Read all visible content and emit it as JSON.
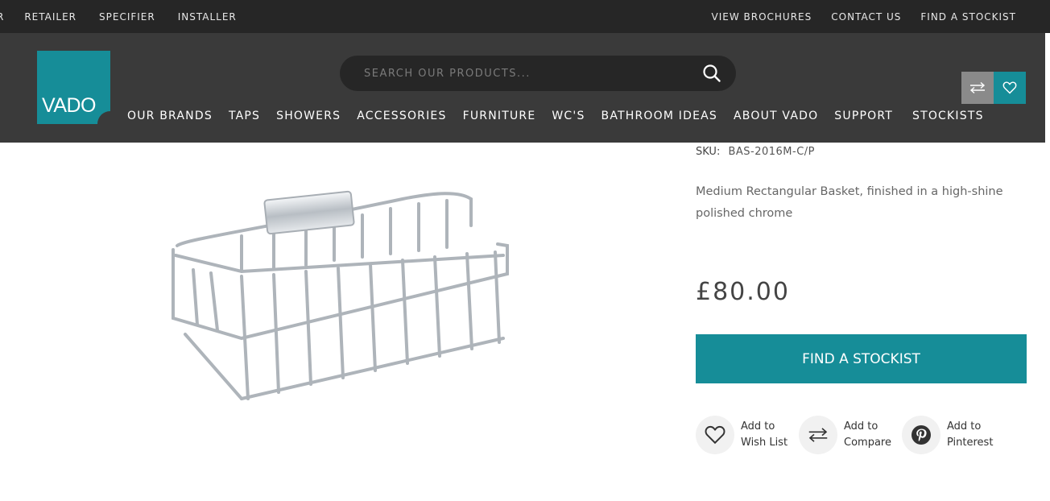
{
  "topbar": {
    "left_links": [
      "R",
      "RETAILER",
      "SPECIFIER",
      "INSTALLER"
    ],
    "right_links": [
      "VIEW BROCHURES",
      "CONTACT US",
      "FIND A STOCKIST"
    ]
  },
  "header": {
    "logo_text": "VADO",
    "search_placeholder": "SEARCH OUR PRODUCTS...",
    "nav": [
      "OUR BRANDS",
      "TAPS",
      "SHOWERS",
      "ACCESSORIES",
      "FURNITURE",
      "WC'S",
      "BATHROOM IDEAS",
      "ABOUT VADO",
      "SUPPORT",
      "STOCKISTS"
    ]
  },
  "product": {
    "sku_label": "SKU:",
    "sku_value": "BAS-2016M-C/P",
    "description": "Medium Rectangular Basket, finished in a high-shine polished chrome",
    "price": "£80.00",
    "cta_label": "FIND A STOCKIST",
    "actions": [
      {
        "line1": "Add to",
        "line2": "Wish List",
        "icon": "heart-icon"
      },
      {
        "line1": "Add to",
        "line2": "Compare",
        "icon": "compare-arrows-icon"
      },
      {
        "line1": "Add to",
        "line2": "Pinterest",
        "icon": "pinterest-icon"
      }
    ]
  },
  "colors": {
    "brand_teal": "#168d98",
    "topbar_bg": "#262626",
    "header_bg": "#3a3a3a"
  }
}
